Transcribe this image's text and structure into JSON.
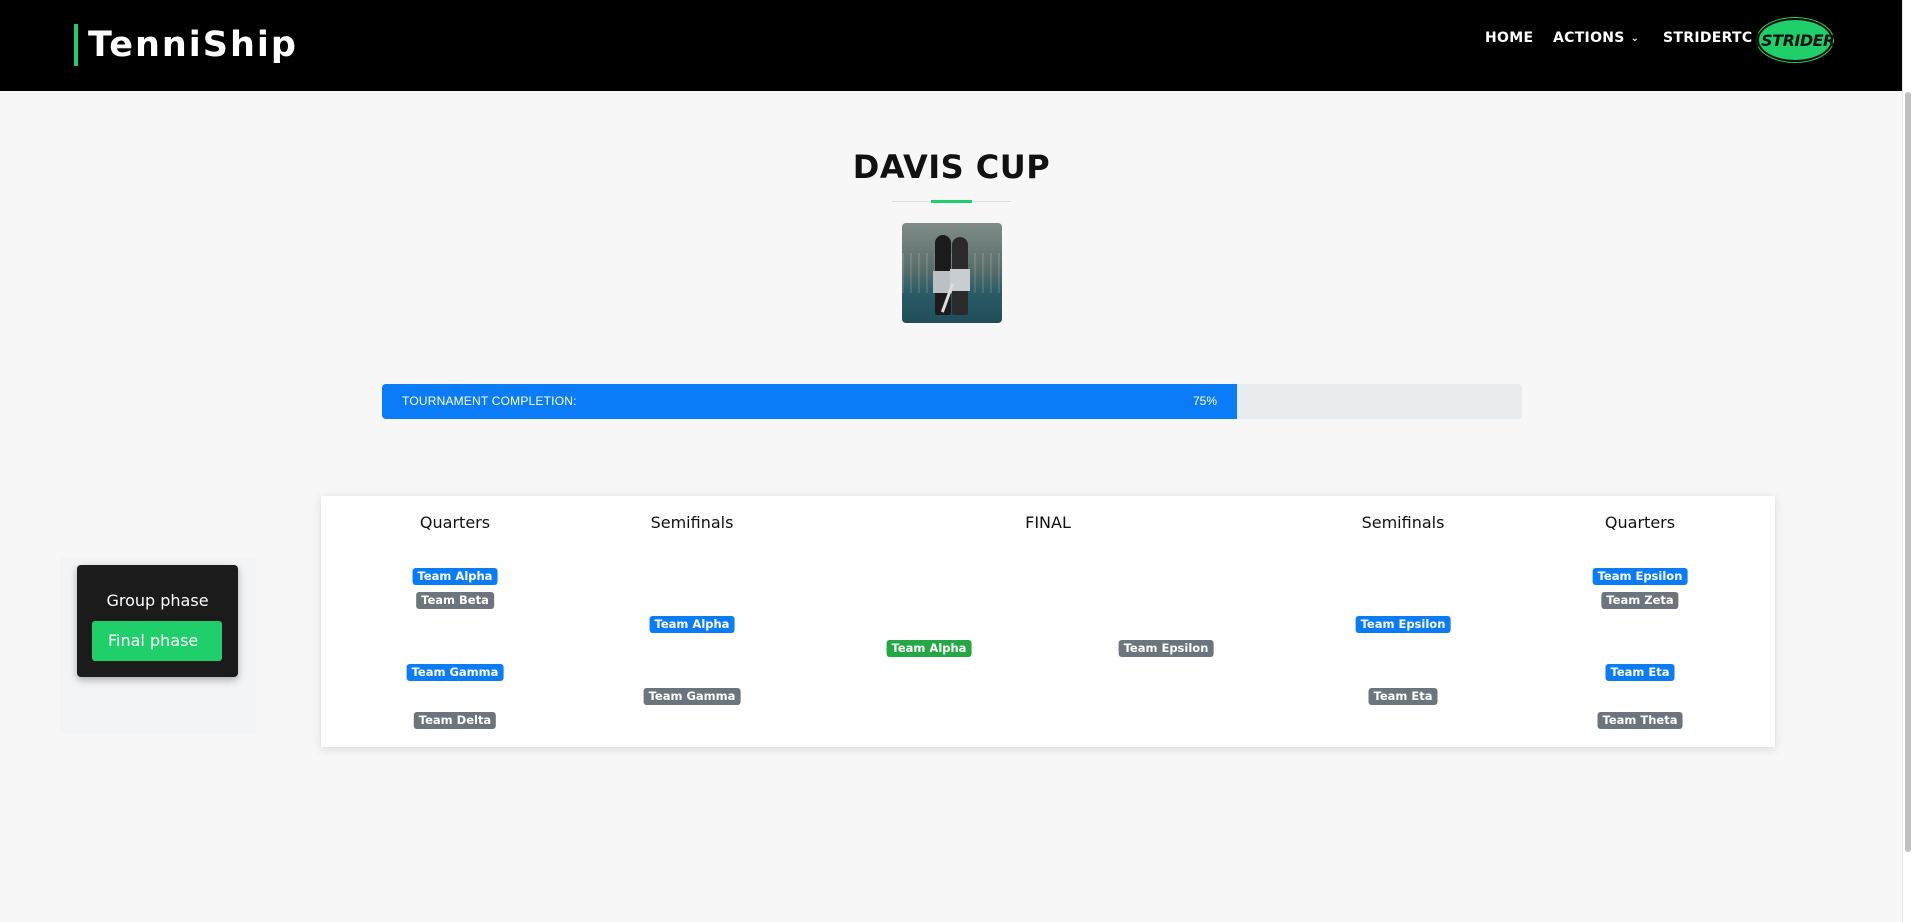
{
  "header": {
    "brand": "TenniShip",
    "nav": {
      "home": "HOME",
      "actions": "ACTIONS",
      "user": "STRIDERTC"
    },
    "avatar_text": "STRIDER"
  },
  "tournament": {
    "name": "DAVIS CUP",
    "completion_label": "TOURNAMENT COMPLETION:",
    "completion_percent": 75,
    "completion_text": "75%"
  },
  "phases": {
    "group": "Group phase",
    "final": "Final phase",
    "active": "final"
  },
  "bracket": {
    "rounds": {
      "left_quarters": "Quarters",
      "left_semis": "Semifinals",
      "final": "FINAL",
      "right_semis": "Semifinals",
      "right_quarters": "Quarters"
    },
    "left_quarters": [
      {
        "name": "Team Alpha",
        "status": "winner"
      },
      {
        "name": "Team Beta",
        "status": "loser"
      },
      {
        "name": "Team Gamma",
        "status": "winner"
      },
      {
        "name": "Team Delta",
        "status": "loser"
      }
    ],
    "left_semis": [
      {
        "name": "Team Alpha",
        "status": "winner"
      },
      {
        "name": "Team Gamma",
        "status": "loser"
      }
    ],
    "final": [
      {
        "name": "Team Alpha",
        "status": "champion"
      },
      {
        "name": "Team Epsilon",
        "status": "loser"
      }
    ],
    "right_semis": [
      {
        "name": "Team Epsilon",
        "status": "winner"
      },
      {
        "name": "Team Eta",
        "status": "loser"
      }
    ],
    "right_quarters": [
      {
        "name": "Team Epsilon",
        "status": "winner"
      },
      {
        "name": "Team Zeta",
        "status": "loser"
      },
      {
        "name": "Team Eta",
        "status": "winner"
      },
      {
        "name": "Team Theta",
        "status": "loser"
      }
    ]
  },
  "colors": {
    "accent": "#1fcf6a",
    "progress": "#0b7cf7",
    "winner": "#0b7cf7",
    "loser": "#6c757d",
    "champion": "#23a845"
  }
}
